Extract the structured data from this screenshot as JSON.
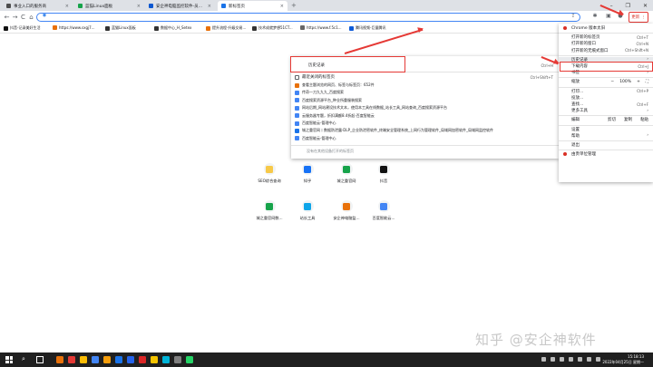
{
  "tabs": [
    {
      "title": "事业入口的服务商",
      "color": "#4d4d4d",
      "active": false
    },
    {
      "title": "蓝猫Linux面板",
      "color": "#16a34a",
      "active": false
    },
    {
      "title": "安企神电脑监控软件-员工CMS后...",
      "color": "#0b57d0",
      "active": false
    },
    {
      "title": "新标签页",
      "color": "#1a73e8",
      "active": true
    }
  ],
  "toolbar": {
    "back": "←",
    "forward": "→",
    "reload": "C",
    "home": "⌂",
    "omnibox_value": "",
    "more_label": "更新"
  },
  "bookmarks": [
    {
      "label": "抖音-记录美好生活",
      "color": "#111"
    },
    {
      "label": "https://www.sxgj7...",
      "color": "#e8710a"
    },
    {
      "label": "蓝猫Linux面板",
      "color": "#333"
    },
    {
      "label": "数据中心_H_Setex",
      "color": "#333"
    },
    {
      "label": "提升流程-升级交易...",
      "color": "#e8710a"
    },
    {
      "label": "技术成就梦想51CT...",
      "color": "#333"
    },
    {
      "label": "https://www.f.5c1...",
      "color": "#666"
    },
    {
      "label": "腾讯视频-巨量腾讯",
      "color": "#0e5bd8"
    }
  ],
  "history": {
    "title": "历史记录",
    "shortcut": "Ctrl+H",
    "recent_closed_title": "最近关闭的标签页",
    "recent_closed_shortcut": "Ctrl+Shift+T",
    "items": [
      {
        "label": "查看主题浏览的网页、标签与标签页：652件",
        "color": "#e8710a"
      },
      {
        "label": "传奇一刀九九九_百度搜索",
        "color": "#4285f4"
      },
      {
        "label": "百度搜索资源平台_种业所重服装搜索",
        "color": "#4285f4"
      },
      {
        "label": "网站后期_网站建设技术文本，使用本工具在线数据_站长工具_网站查询_百度搜索资源平台",
        "color": "#4285f4"
      },
      {
        "label": "云服务器专题，折扣满额8.4折起-百度智能云",
        "color": "#4285f4"
      },
      {
        "label": "百度智能云-管理中心",
        "color": "#4285f4"
      },
      {
        "label": "城之重官网丨数据防泄露·DLP_企业防泄密软件_终端安全管理系统_上网行为管理软件_局域网加密软件_局域网监控软件",
        "color": "#1a73e8"
      },
      {
        "label": "百度智能云-管理中心",
        "color": "#4285f4"
      }
    ],
    "footer": "没有在其他设备打开的标签页"
  },
  "menu": {
    "items": [
      {
        "label": "Chrome 版本太旧",
        "sc": "",
        "arrow": false,
        "icon": true
      },
      {
        "sep": true
      },
      {
        "label": "打开新的标签页",
        "sc": "Ctrl+T"
      },
      {
        "label": "打开新的窗口",
        "sc": "Ctrl+N"
      },
      {
        "label": "打开新的无痕式窗口",
        "sc": "Ctrl+Shift+N"
      },
      {
        "sep": true
      },
      {
        "label": "历史记录",
        "sc": "",
        "arrow": true,
        "highlight": true
      },
      {
        "label": "下载内容",
        "sc": "Ctrl+J"
      },
      {
        "label": "书签",
        "sc": "",
        "arrow": true
      },
      {
        "sep": true
      },
      {
        "label": "缩放",
        "sc": "",
        "zoom": true
      },
      {
        "sep": true
      },
      {
        "label": "打印...",
        "sc": "Ctrl+P"
      },
      {
        "label": "投放...",
        "sc": ""
      },
      {
        "label": "查找...",
        "sc": "Ctrl+F"
      },
      {
        "label": "更多工具",
        "sc": "",
        "arrow": true
      },
      {
        "sep": true
      },
      {
        "label": "编辑",
        "sc": "",
        "edit": true
      },
      {
        "sep": true
      },
      {
        "label": "设置",
        "sc": ""
      },
      {
        "label": "帮助",
        "sc": "",
        "arrow": true
      },
      {
        "sep": true
      },
      {
        "label": "退出",
        "sc": ""
      },
      {
        "sep": true
      },
      {
        "label": "由贵单位管理",
        "sc": "",
        "icon": true
      }
    ],
    "zoom": {
      "minus": "−",
      "value": "100%",
      "plus": "+",
      "full": "⛶"
    },
    "edit": {
      "cut": "剪切",
      "copy": "复制",
      "paste": "粘贴"
    }
  },
  "shortcuts_row1": [
    {
      "label": "SEO综合查询",
      "color": "#f7c948"
    },
    {
      "label": "知乎",
      "color": "#1772f6"
    },
    {
      "label": "城之重官网",
      "color": "#16a34a"
    },
    {
      "label": "抖音",
      "color": "#111"
    }
  ],
  "shortcuts_row2": [
    {
      "label": "城之重官网数...",
      "color": "#16a34a"
    },
    {
      "label": "站长工具",
      "color": "#0ea5e9"
    },
    {
      "label": "安企神电脑监...",
      "color": "#e8710a"
    },
    {
      "label": "百度智能云...",
      "color": "#4285f4"
    }
  ],
  "watermark": "知乎 @安企神软件",
  "taskbar": {
    "apps": [
      "#e8710a",
      "#e53935",
      "#fbbc04",
      "#4285f4",
      "#f59e0b",
      "#1a73e8",
      "#2563eb",
      "#dc2626",
      "#f5c400",
      "#00b4d8",
      "#7f7f7f",
      "#25d366"
    ],
    "time": "15:18:13",
    "date": "2022年04月25日 星期一"
  },
  "colors": {
    "accent": "#e53935",
    "chrome_blue": "#4285f4"
  }
}
